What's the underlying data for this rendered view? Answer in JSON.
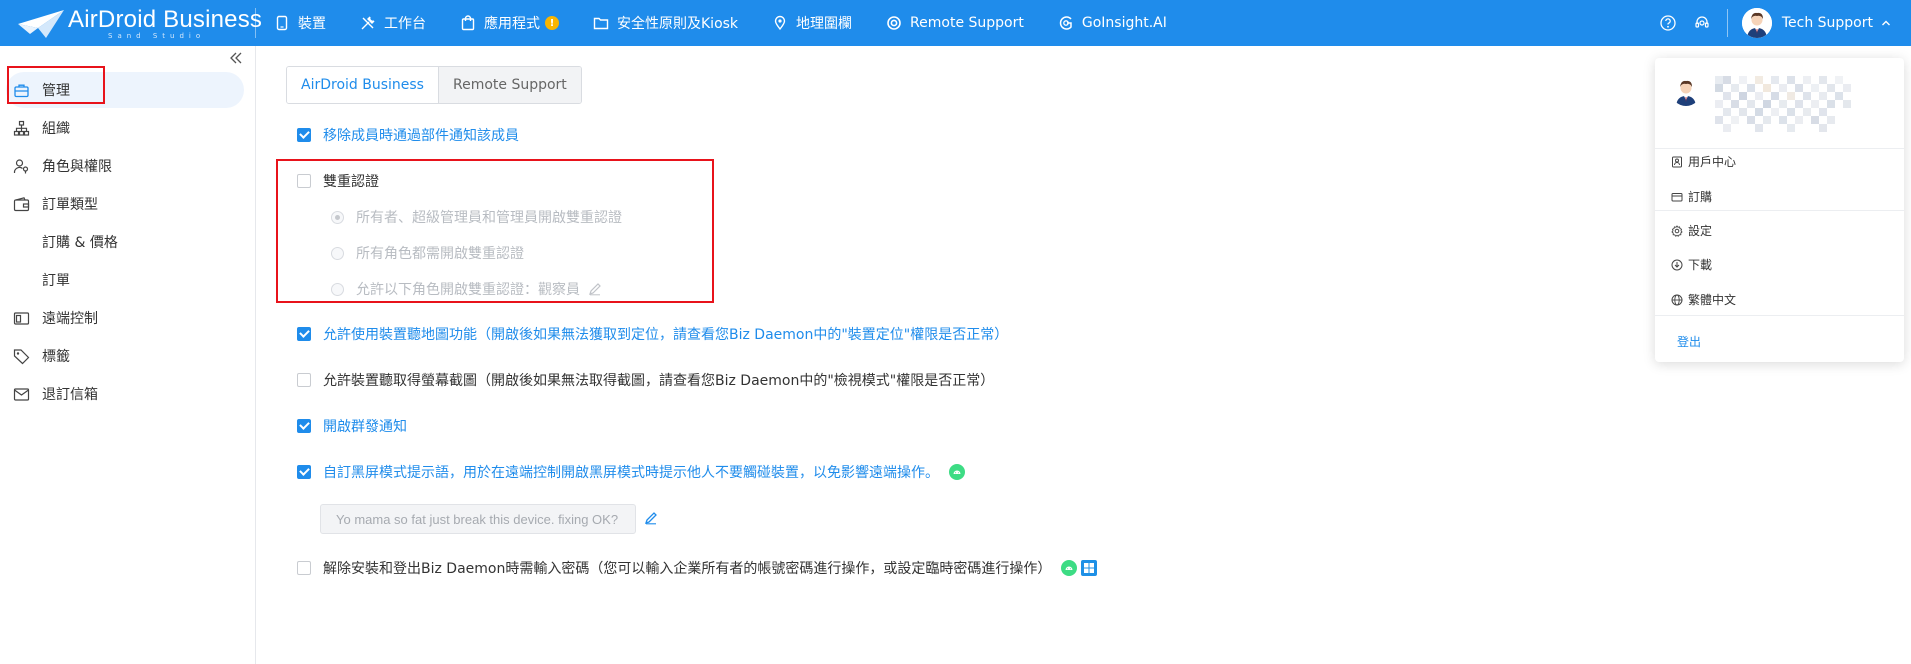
{
  "brand": {
    "name": "AirDroid Business",
    "sub": "Sand Studio",
    "colors": {
      "primary": "#1f8ceb",
      "highlight": "#e8131b",
      "badge": "#f8b500",
      "android": "#3ddc84",
      "windows": "#00a4ef"
    }
  },
  "nav": {
    "items": [
      {
        "label": "裝置",
        "icon": "phone-icon"
      },
      {
        "label": "工作台",
        "icon": "tools-icon"
      },
      {
        "label": "應用程式",
        "icon": "app-bag-icon",
        "badge": "!"
      },
      {
        "label": "安全性原則及Kiosk",
        "icon": "folder-icon"
      },
      {
        "label": "地理圍欄",
        "icon": "map-pin-icon"
      },
      {
        "label": "Remote Support",
        "icon": "lifebuoy-icon"
      },
      {
        "label": "GoInsight.AI",
        "icon": "ai-icon"
      }
    ],
    "user": "Tech Support"
  },
  "sidebar": {
    "items": [
      {
        "label": "管理",
        "icon": "briefcase-icon"
      },
      {
        "label": "組織",
        "icon": "org-chart-icon"
      },
      {
        "label": "角色與權限",
        "icon": "user-key-icon"
      },
      {
        "label": "訂單類型",
        "icon": "wallet-icon"
      },
      {
        "label": "訂購 & 價格"
      },
      {
        "label": "訂單"
      },
      {
        "label": "遠端控制",
        "icon": "remote-icon"
      },
      {
        "label": "標籤",
        "icon": "tag-icon"
      },
      {
        "label": "退訂信箱",
        "icon": "mail-icon"
      }
    ]
  },
  "tabs": [
    {
      "label": "AirDroid Business",
      "active": true
    },
    {
      "label": "Remote Support",
      "active": false
    }
  ],
  "settings": {
    "notify_dept": {
      "label": "移除成員時通過部件通知該成員",
      "checked": true
    },
    "two_factor": {
      "label": "雙重認證",
      "checked": false,
      "options": [
        "所有者、超級管理員和管理員開啟雙重認證",
        "所有角色都需開啟雙重認證",
        "允許以下角色開啟雙重認證：觀察員"
      ]
    },
    "geofence": {
      "label": "允許使用裝置聽地圖功能（開啟後如果無法獲取到定位，請查看您Biz Daemon中的\"裝置定位\"權限是否正常）",
      "checked": true
    },
    "screenshot": {
      "label": "允許裝置聽取得螢幕截圖（開啟後如果無法取得截圖，請查看您Biz Daemon中的\"檢視模式\"權限是否正常）",
      "checked": false
    },
    "group_notify": {
      "label": "開啟群發通知",
      "checked": true
    },
    "black_screen": {
      "label": "自訂黑屏模式提示語，用於在遠端控制開啟黑屏模式時提示他人不要觸碰裝置，以免影響遠端操作。",
      "checked": true,
      "message": "Yo mama so fat just break this device. fixing OK?"
    },
    "uninstall_pwd": {
      "label": "解除安裝和登出Biz Daemon時需輸入密碼（您可以輸入企業所有者的帳號密碼進行操作，或設定臨時密碼進行操作）",
      "checked": false
    }
  },
  "user_menu": {
    "items": [
      {
        "label": "用戶中心",
        "icon": "id-card-icon"
      },
      {
        "label": "訂購",
        "icon": "card-icon"
      },
      {
        "label": "設定",
        "icon": "gear-icon"
      },
      {
        "label": "下載",
        "icon": "download-icon"
      },
      {
        "label": "繁體中文",
        "icon": "globe-icon"
      }
    ],
    "logout": "登出"
  }
}
